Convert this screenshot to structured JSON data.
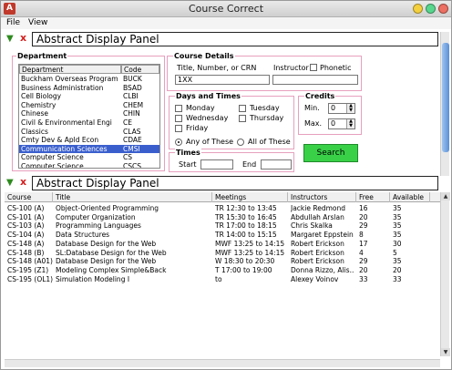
{
  "window": {
    "title": "Course Correct"
  },
  "menu": {
    "file": "File",
    "view": "View"
  },
  "top_panel": {
    "title": "Abstract Display Panel"
  },
  "department": {
    "label": "Department",
    "col_name": "Department",
    "col_code": "Code",
    "rows": [
      {
        "name": "Buckham Overseas Program",
        "code": "BUCK"
      },
      {
        "name": "Business Administration",
        "code": "BSAD"
      },
      {
        "name": "Cell Biology",
        "code": "CLBI"
      },
      {
        "name": "Chemistry",
        "code": "CHEM"
      },
      {
        "name": "Chinese",
        "code": "CHIN"
      },
      {
        "name": "Civil & Environmental Engi",
        "code": "CE"
      },
      {
        "name": "Classics",
        "code": "CLAS"
      },
      {
        "name": "Cmty Dev & Apld Econ",
        "code": "CDAE"
      },
      {
        "name": "Communication Sciences",
        "code": "CMSI"
      },
      {
        "name": "Computer Science",
        "code": "CS"
      },
      {
        "name": "Computer Science",
        "code": "CSCS"
      }
    ],
    "selected_index": 8
  },
  "course_details": {
    "label": "Course Details",
    "title_label": "Title, Number, or CRN",
    "title_value": "1XX",
    "instructor_label": "Instructor",
    "phonetic_label": "Phonetic",
    "instructor_value": ""
  },
  "days_times": {
    "label": "Days and Times",
    "monday": "Monday",
    "tuesday": "Tuesday",
    "wednesday": "Wednesday",
    "thursday": "Thursday",
    "friday": "Friday",
    "any_of_these": "Any of These",
    "all_of_these": "All of These"
  },
  "times": {
    "label": "Times",
    "start_label": "Start",
    "end_label": "End",
    "start_value": "",
    "end_value": ""
  },
  "credits": {
    "label": "Credits",
    "min_label": "Min.",
    "max_label": "Max.",
    "min_value": "0",
    "max_value": "0"
  },
  "search": {
    "label": "Search"
  },
  "bottom_panel": {
    "title": "Abstract Display Panel"
  },
  "results": {
    "columns": [
      "Course",
      "Title",
      "Meetings",
      "Instructors",
      "Free",
      "Available"
    ],
    "rows": [
      [
        "CS-100 (A)",
        "Object-Oriented Programming",
        "TR 12:30 to 13:45",
        "Jackie Redmond",
        "16",
        "35"
      ],
      [
        "CS-101 (A)",
        "Computer Organization",
        "TR 15:30 to 16:45",
        "Abdullah Arslan",
        "20",
        "35"
      ],
      [
        "CS-103 (A)",
        "Programming Languages",
        "TR 17:00 to 18:15",
        "Chris Skalka",
        "29",
        "35"
      ],
      [
        "CS-104 (A)",
        "Data Structures",
        "TR 14:00 to 15:15",
        "Margaret Eppstein",
        "8",
        "35"
      ],
      [
        "CS-148 (A)",
        "Database Design for the Web",
        "MWF 13:25 to 14:15",
        "Robert Erickson",
        "17",
        "30"
      ],
      [
        "CS-148 (B)",
        "SL:Database Design for the Web",
        "MWF 13:25 to 14:15",
        "Robert Erickson",
        "4",
        "5"
      ],
      [
        "CS-148 (A01)",
        "Database Design for the Web",
        "W 18:30 to 20:30",
        "Robert Erickson",
        "29",
        "35"
      ],
      [
        "CS-195 (Z1)",
        "Modeling Complex Simple&Back",
        "T 17:00 to 19:00",
        "Donna Rizzo, Alis...",
        "20",
        "20"
      ],
      [
        "CS-195 (OL1)",
        "Simulation Modeling I",
        "to",
        "Alexey Voinov",
        "33",
        "33"
      ]
    ]
  }
}
